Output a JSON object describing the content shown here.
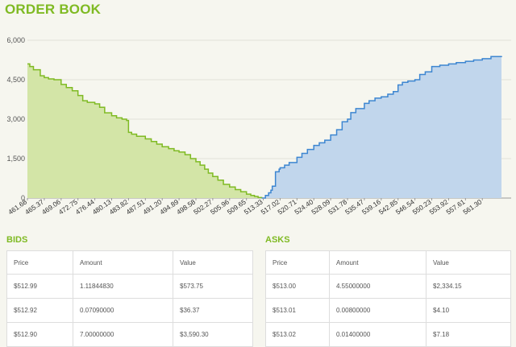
{
  "page": {
    "title": "ORDER BOOK"
  },
  "colors": {
    "accent": "#7fba23",
    "bid_line": "#7fba23",
    "bid_fill": "#d3e5a7",
    "ask_line": "#3d86d1",
    "ask_fill": "#c1d6ec"
  },
  "chart_data": {
    "type": "area",
    "title": "",
    "xlabel": "",
    "ylabel": "",
    "xlim": [
      461.68,
      565.5
    ],
    "ylim": [
      0,
      6000
    ],
    "y_ticks": [
      "0",
      "1,500",
      "3,000",
      "4,500",
      "6,000"
    ],
    "x_ticks": [
      "461.68",
      "465.37",
      "469.06",
      "472.75",
      "476.44",
      "480.13",
      "483.82",
      "487.51",
      "491.20",
      "494.89",
      "498.58",
      "502.27",
      "505.96",
      "509.65",
      "513.33",
      "517.02",
      "520.71",
      "524.40",
      "528.09",
      "531.78",
      "535.47",
      "539.16",
      "542.85",
      "546.54",
      "550.23",
      "553.92",
      "557.61",
      "561.30"
    ],
    "grid": true,
    "series": [
      {
        "side": "bids",
        "x": [
          461.68,
          462.2,
          463.0,
          464.5,
          465.37,
          466.3,
          467.5,
          469.06,
          470.2,
          471.5,
          472.75,
          473.8,
          474.8,
          476.44,
          477.5,
          478.6,
          480.13,
          481.2,
          482.4,
          483.4,
          483.82,
          484.5,
          485.6,
          487.51,
          488.8,
          490.0,
          491.2,
          492.6,
          493.8,
          494.89,
          496.2,
          497.4,
          498.58,
          499.5,
          500.5,
          501.3,
          502.27,
          503.4,
          504.6,
          505.96,
          507.2,
          508.4,
          509.65,
          510.6,
          511.4,
          512.2,
          512.99
        ],
        "y": [
          5100,
          5000,
          4880,
          4650,
          4580,
          4530,
          4500,
          4320,
          4200,
          4080,
          3900,
          3700,
          3640,
          3580,
          3450,
          3240,
          3130,
          3050,
          3000,
          2950,
          2500,
          2430,
          2350,
          2250,
          2150,
          2050,
          1950,
          1880,
          1800,
          1750,
          1650,
          1500,
          1380,
          1250,
          1100,
          950,
          820,
          680,
          520,
          420,
          320,
          240,
          150,
          100,
          60,
          20,
          0
        ]
      },
      {
        "side": "asks",
        "x": [
          513.0,
          513.8,
          514.5,
          515.0,
          515.3,
          516.0,
          516.8,
          517.02,
          518.0,
          519.0,
          520.71,
          521.8,
          523.0,
          524.4,
          525.6,
          526.8,
          528.09,
          529.4,
          530.6,
          531.78,
          532.5,
          533.6,
          535.47,
          536.5,
          537.8,
          539.16,
          540.6,
          541.8,
          542.85,
          543.8,
          545.0,
          546.54,
          547.6,
          548.8,
          550.23,
          552.0,
          553.92,
          555.6,
          557.61,
          559.4,
          561.3,
          563.2,
          565.5
        ],
        "y": [
          0,
          100,
          200,
          300,
          450,
          1000,
          1100,
          1150,
          1250,
          1350,
          1550,
          1700,
          1850,
          2000,
          2100,
          2200,
          2400,
          2600,
          2900,
          3000,
          3250,
          3400,
          3600,
          3700,
          3800,
          3850,
          3950,
          4050,
          4300,
          4400,
          4450,
          4500,
          4700,
          4800,
          5000,
          5050,
          5100,
          5150,
          5200,
          5250,
          5300,
          5380,
          5400
        ]
      }
    ]
  },
  "bids": {
    "label": "BIDS",
    "columns": [
      "Price",
      "Amount",
      "Value"
    ],
    "rows": [
      [
        "$512.99",
        "1.11844830",
        "$573.75"
      ],
      [
        "$512.92",
        "0.07090000",
        "$36.37"
      ],
      [
        "$512.90",
        "7.00000000",
        "$3,590.30"
      ]
    ]
  },
  "asks": {
    "label": "ASKS",
    "columns": [
      "Price",
      "Amount",
      "Value"
    ],
    "rows": [
      [
        "$513.00",
        "4.55000000",
        "$2,334.15"
      ],
      [
        "$513.01",
        "0.00800000",
        "$4.10"
      ],
      [
        "$513.02",
        "0.01400000",
        "$7.18"
      ]
    ]
  }
}
